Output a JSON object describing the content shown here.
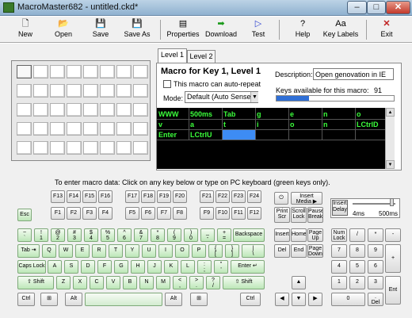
{
  "window": {
    "title": "MacroMaster682 - untitled.ckd*",
    "min": "–",
    "max": "□",
    "close": "✕"
  },
  "toolbar": {
    "new": "New",
    "open": "Open",
    "save": "Save",
    "saveas": "Save As",
    "properties": "Properties",
    "download": "Download",
    "test": "Test",
    "help": "Help",
    "keylabels": "Key Labels",
    "exit": "Exit"
  },
  "tabs": [
    "Level 1",
    "Level 2"
  ],
  "macro": {
    "title": "Macro for Key 1, Level 1",
    "description_label": "Description:",
    "description_value": "Open genovation in IE",
    "autorepeat_label": "This macro can auto-repeat",
    "keys_available_label": "Keys available for this macro:",
    "keys_available_count": "91",
    "keys_available_fraction": 0.28,
    "mode_label": "Mode:",
    "mode_value": "Default (Auto Sense)"
  },
  "sequence": {
    "rows": [
      [
        "WWW",
        "500ms",
        "Tab",
        "g",
        "e",
        "n",
        "o"
      ],
      [
        "v",
        "a",
        "t",
        "i",
        "o",
        "n",
        "LCtrlD"
      ],
      [
        "Enter",
        "LCtrlU",
        "",
        "",
        "",
        "",
        ""
      ]
    ]
  },
  "hint": "To enter macro data:  Click on any key below or type on PC keyboard (green keys only).",
  "delay": {
    "label1": "Insert",
    "label2": "Delay",
    "min": "4ms",
    "max": "500ms"
  },
  "keys": {
    "esc": "Esc",
    "f13": "F13",
    "f14": "F14",
    "f15": "F15",
    "f16": "F16",
    "f17": "F17",
    "f18": "F18",
    "f19": "F19",
    "f20": "F20",
    "f21": "F21",
    "f22": "F22",
    "f23": "F23",
    "f24": "F24",
    "f1": "F1",
    "f2": "F2",
    "f3": "F3",
    "f4": "F4",
    "f5": "F5",
    "f6": "F6",
    "f7": "F7",
    "f8": "F8",
    "f9": "F9",
    "f10": "F10",
    "f11": "F11",
    "f12": "F12",
    "power": "⏻",
    "media_top": "Insert",
    "media_bottom": "Media ▶",
    "prtscr_top": "Print",
    "prtscr_bottom": "Scr",
    "scroll_top": "Scroll",
    "scroll_bottom": "Lock",
    "pause_top": "Pause",
    "pause_bottom": "Break",
    "backtick_top": "~",
    "backtick_bottom": "`",
    "n1_top": "!",
    "n1_bottom": "1",
    "n2_top": "@",
    "n2_bottom": "2",
    "n3_top": "#",
    "n3_bottom": "3",
    "n4_top": "$",
    "n4_bottom": "4",
    "n5_top": "%",
    "n5_bottom": "5",
    "n6_top": "^",
    "n6_bottom": "6",
    "n7_top": "&",
    "n7_bottom": "7",
    "n8_top": "*",
    "n8_bottom": "8",
    "n9_top": "(",
    "n9_bottom": "9",
    "n0_top": ")",
    "n0_bottom": "0",
    "minus_top": "_",
    "minus_bottom": "-",
    "equal_top": "+",
    "equal_bottom": "=",
    "backspace": "Backspace",
    "insert": "Insert",
    "home": "Home",
    "pageup_top": "Page",
    "pageup_bottom": "Up",
    "numlock_top": "Num",
    "numlock_bottom": "Lock",
    "kp_div": "/",
    "kp_mul": "*",
    "kp_minus": "-",
    "tab": "Tab ⇥",
    "q": "Q",
    "w": "W",
    "e": "E",
    "r": "R",
    "t": "T",
    "y": "Y",
    "u": "U",
    "i": "I",
    "o": "O",
    "p": "P",
    "lbrace_top": "{",
    "lbrace_bottom": "[",
    "rbrace_top": "}",
    "rbrace_bottom": "]",
    "pipe_top": "|",
    "pipe_bottom": "\\",
    "del": "Del",
    "end": "End",
    "pagedown_top": "Page",
    "pagedown_bottom": "Down",
    "kp7": "7",
    "kp8": "8",
    "kp9": "9",
    "kp_plus": "+",
    "capslock": "Caps Lock",
    "a": "A",
    "s": "S",
    "d": "D",
    "f": "F",
    "g": "G",
    "h": "H",
    "j": "J",
    "k": "K",
    "l": "L",
    "semi_top": ":",
    "semi_bottom": ";",
    "quote_top": "\"",
    "quote_bottom": "'",
    "enter": "Enter ↵",
    "kp4": "4",
    "kp5": "5",
    "kp6": "6",
    "lshift": "⇧ Shift",
    "z": "Z",
    "x": "X",
    "c": "C",
    "v": "V",
    "b": "B",
    "n": "N",
    "m": "M",
    "comma_top": "<",
    "comma_bottom": ",",
    "period_top": ">",
    "period_bottom": ".",
    "slash_top": "?",
    "slash_bottom": "/",
    "rshift": "⇧ Shift",
    "up": "▲",
    "kp1": "1",
    "kp2": "2",
    "kp3": "3",
    "kp_enter": "Ent",
    "lctrl": "Ctrl",
    "lwin": "⊞",
    "lalt": "Alt",
    "ralt": "Alt",
    "rwin": "⊞",
    "rctrl": "Ctrl",
    "left": "◀",
    "down": "▼",
    "right": "▶",
    "kp0": "0",
    "kpdot_top": ".",
    "kpdot_bottom": "Del"
  }
}
